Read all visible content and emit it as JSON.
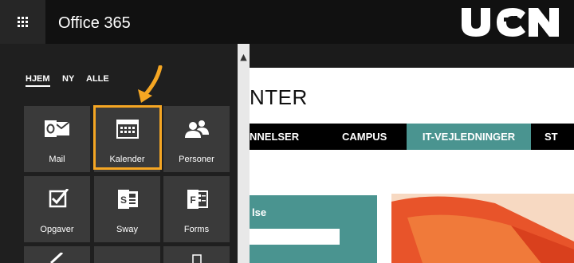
{
  "topbar": {
    "app_title": "Office 365",
    "brand": "UCN"
  },
  "panel": {
    "tabs": [
      {
        "label": "HJEM",
        "active": true
      },
      {
        "label": "NY",
        "active": false
      },
      {
        "label": "ALLE",
        "active": false
      }
    ],
    "tiles": [
      {
        "label": "Mail",
        "icon": "outlook-mail-icon"
      },
      {
        "label": "Kalender",
        "icon": "calendar-icon",
        "highlighted": true
      },
      {
        "label": "Personer",
        "icon": "people-icon"
      },
      {
        "label": "Opgaver",
        "icon": "tasks-checkbox-icon"
      },
      {
        "label": "Sway",
        "icon": "sway-icon"
      },
      {
        "label": "Forms",
        "icon": "forms-icon"
      }
    ]
  },
  "site": {
    "heading": "NTER",
    "nav": [
      {
        "label": "NNELSER",
        "active": false
      },
      {
        "label": "CAMPUS",
        "active": false
      },
      {
        "label": "IT-VEJLEDNINGER",
        "active": true
      },
      {
        "label": "ST",
        "active": false
      }
    ],
    "card_label": "lse"
  },
  "colors": {
    "accent_teal": "#4a9490",
    "highlight_orange": "#f5a623",
    "panel_bg": "#1f1f1f",
    "tile_bg": "#3a3a3a"
  }
}
